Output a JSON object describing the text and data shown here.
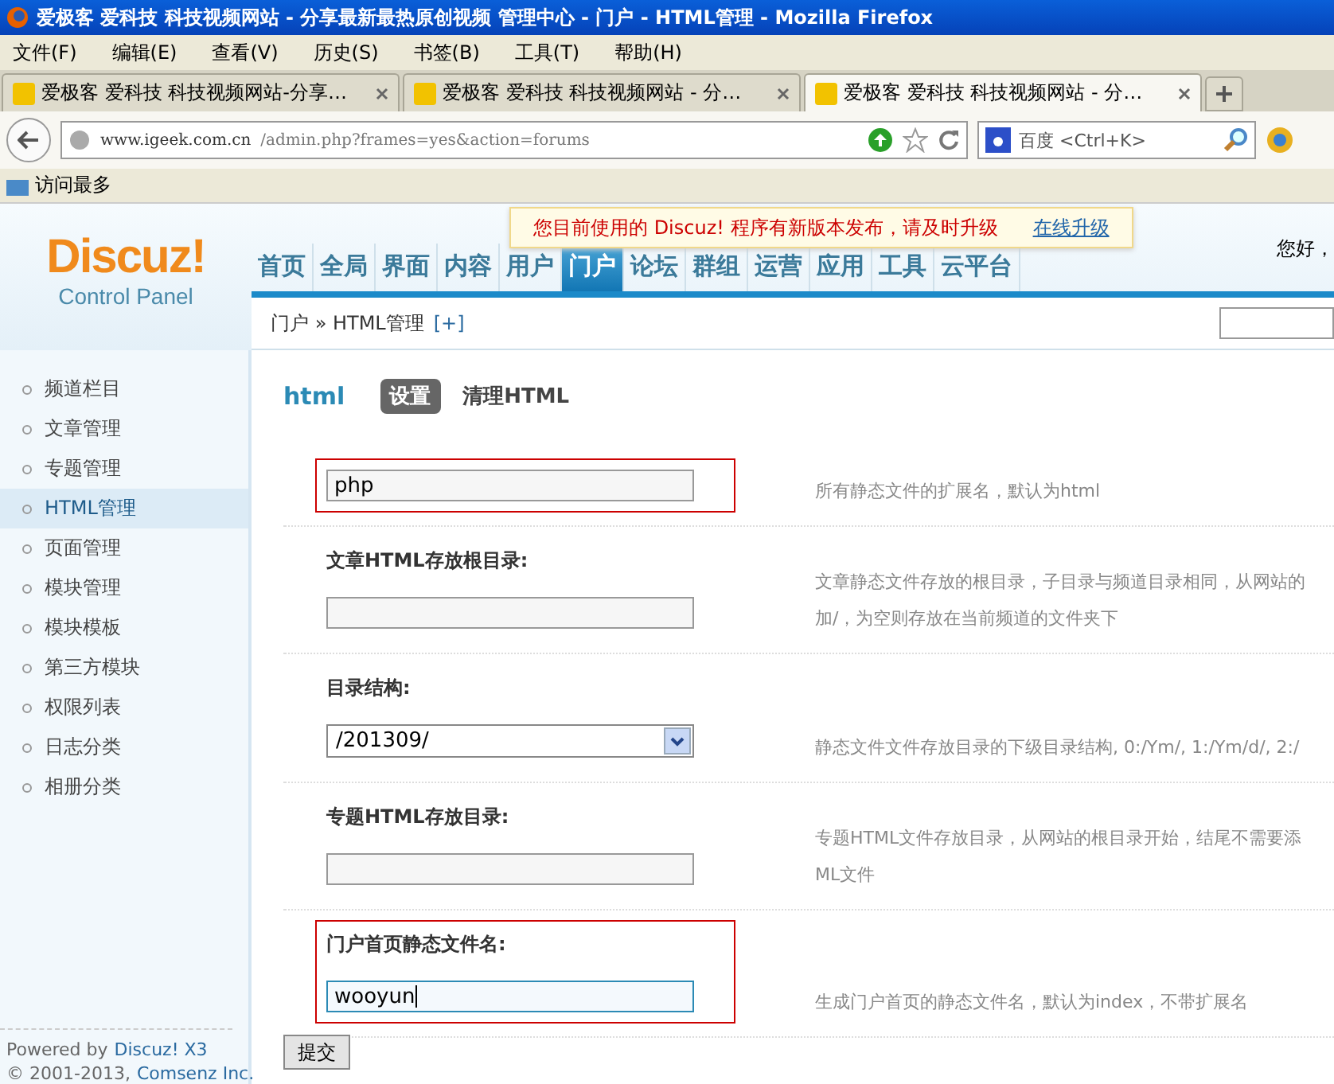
{
  "window": {
    "title": "爱极客 爱科技 科技视频网站 - 分享最新最热原创视频 管理中心 - 门户 - HTML管理 - Mozilla Firefox"
  },
  "menu": [
    "文件(F)",
    "编辑(E)",
    "查看(V)",
    "历史(S)",
    "书签(B)",
    "工具(T)",
    "帮助(H)"
  ],
  "tabs": [
    {
      "label": "爱极客 爱科技 科技视频网站-分享…",
      "selected": false
    },
    {
      "label": "爱极客 爱科技 科技视频网站 - 分…",
      "selected": false
    },
    {
      "label": "爱极客 爱科技 科技视频网站 - 分…",
      "selected": true
    }
  ],
  "address": {
    "host": "www.igeek.com.cn",
    "path": "/admin.php?frames=yes&action=forums"
  },
  "search": {
    "engine": "百度",
    "placeholder": "<Ctrl+K>"
  },
  "bookmarks": [
    "访问最多"
  ],
  "notice": {
    "text": "您目前使用的 Discuz! 程序有新版本发布，请及时升级",
    "link": "在线升级"
  },
  "logo": {
    "name": "Discuz!",
    "subtitle": "Control Panel"
  },
  "greeting": "您好，",
  "nav": [
    {
      "label": "首页",
      "selected": false
    },
    {
      "label": "全局",
      "selected": false
    },
    {
      "label": "界面",
      "selected": false
    },
    {
      "label": "内容",
      "selected": false
    },
    {
      "label": "用户",
      "selected": false
    },
    {
      "label": "门户",
      "selected": true
    },
    {
      "label": "论坛",
      "selected": false
    },
    {
      "label": "群组",
      "selected": false
    },
    {
      "label": "运营",
      "selected": false
    },
    {
      "label": "应用",
      "selected": false
    },
    {
      "label": "工具",
      "selected": false
    },
    {
      "label": "云平台",
      "selected": false
    }
  ],
  "breadcrumb": {
    "path": "门户 » HTML管理",
    "add": "[+]"
  },
  "sidebar": [
    {
      "label": "频道栏目",
      "selected": false
    },
    {
      "label": "文章管理",
      "selected": false
    },
    {
      "label": "专题管理",
      "selected": false
    },
    {
      "label": "HTML管理",
      "selected": true
    },
    {
      "label": "页面管理",
      "selected": false
    },
    {
      "label": "模块管理",
      "selected": false
    },
    {
      "label": "模块模板",
      "selected": false
    },
    {
      "label": "第三方模块",
      "selected": false
    },
    {
      "label": "权限列表",
      "selected": false
    },
    {
      "label": "日志分类",
      "selected": false
    },
    {
      "label": "相册分类",
      "selected": false
    }
  ],
  "footer": {
    "powered": "Powered by",
    "brand": "Discuz! X3",
    "copyright": "© 2001-2013,",
    "company": "Comsenz Inc."
  },
  "section": {
    "title": "html",
    "tabs": [
      {
        "label": "设置",
        "selected": true
      },
      {
        "label": "清理HTML",
        "selected": false
      }
    ]
  },
  "form": [
    {
      "kind": "text",
      "value": "php",
      "highlighted": true,
      "focused": false,
      "hint": [
        "所有静态文件的扩展名，默认为html"
      ]
    },
    {
      "kind": "text",
      "label": "文章HTML存放根目录:",
      "highlighted": false,
      "focused": false,
      "hint": [
        "文章静态文件存放的根目录，子目录与频道目录相同，从网站的",
        "加/，为空则存放在当前频道的文件夹下"
      ]
    },
    {
      "kind": "select",
      "label": "目录结构:",
      "value": "/201309/",
      "highlighted": false,
      "focused": false,
      "hint": [
        "静态文件文件存放目录的下级目录结构, 0:/Ym/, 1:/Ym/d/, 2:/"
      ]
    },
    {
      "kind": "text",
      "label": "专题HTML存放目录:",
      "highlighted": false,
      "focused": false,
      "hint": [
        "专题HTML文件存放目录，从网站的根目录开始，结尾不需要添",
        "ML文件"
      ]
    },
    {
      "kind": "text",
      "label": "门户首页静态文件名:",
      "value": "wooyun",
      "highlighted": true,
      "focused": true,
      "hint": [
        "生成门户首页的静态文件名，默认为index，不带扩展名"
      ]
    }
  ],
  "submit": "提交"
}
